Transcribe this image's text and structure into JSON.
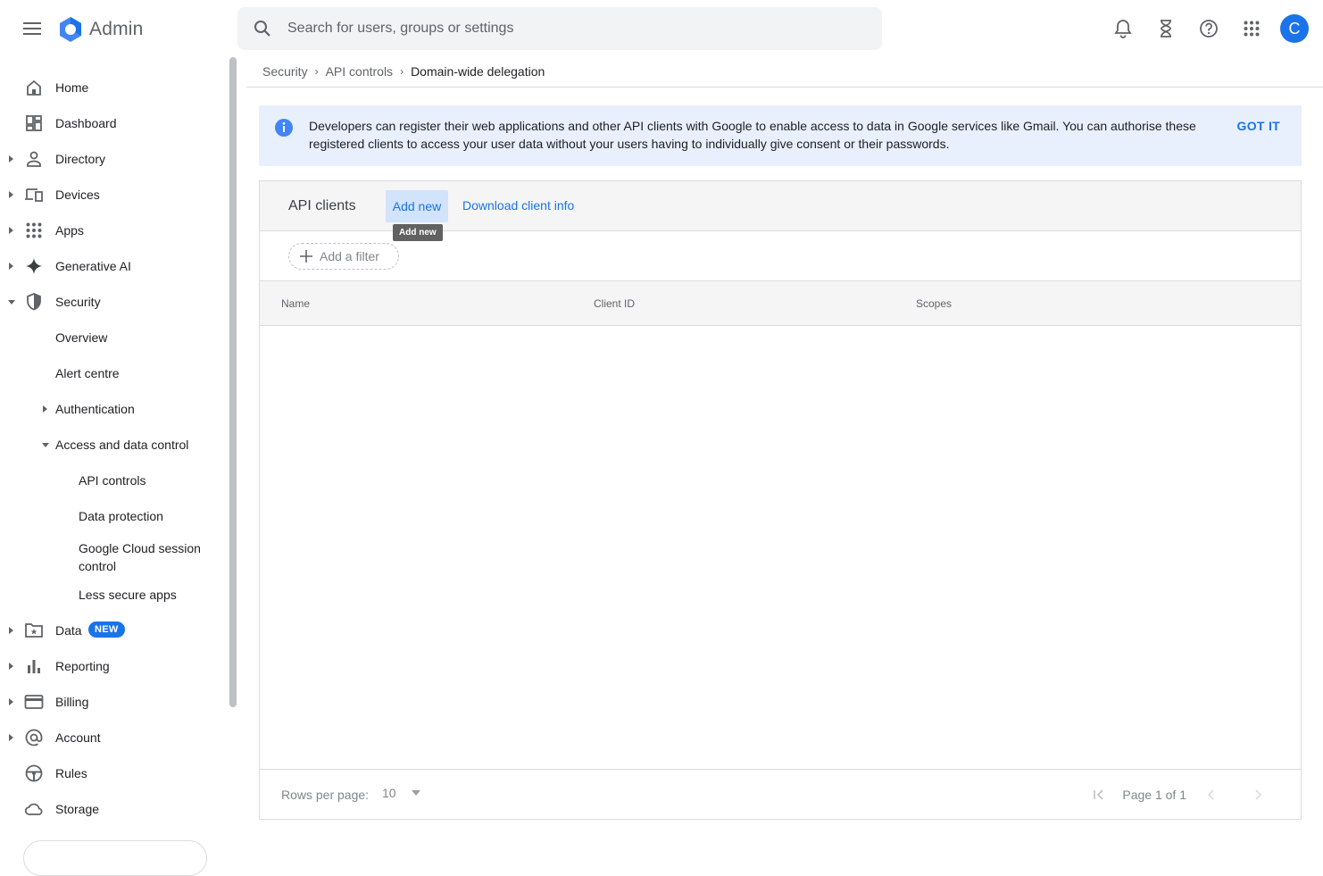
{
  "app": {
    "title": "Admin",
    "avatar_letter": "C",
    "accent": "#1a73e8"
  },
  "search": {
    "placeholder": "Search for users, groups or settings"
  },
  "sidebar": {
    "items": [
      {
        "label": "Home"
      },
      {
        "label": "Dashboard"
      },
      {
        "label": "Directory"
      },
      {
        "label": "Devices"
      },
      {
        "label": "Apps"
      },
      {
        "label": "Generative AI"
      },
      {
        "label": "Security"
      },
      {
        "label": "Overview"
      },
      {
        "label": "Alert centre"
      },
      {
        "label": "Authentication"
      },
      {
        "label": "Access and data control"
      },
      {
        "label": "API controls"
      },
      {
        "label": "Data protection"
      },
      {
        "label": "Google Cloud session control"
      },
      {
        "label": "Less secure apps"
      },
      {
        "label": "Data",
        "badge": "NEW"
      },
      {
        "label": "Reporting"
      },
      {
        "label": "Billing"
      },
      {
        "label": "Account"
      },
      {
        "label": "Rules"
      },
      {
        "label": "Storage"
      }
    ]
  },
  "breadcrumb": {
    "items": [
      "Security",
      "API controls"
    ],
    "current": "Domain-wide delegation"
  },
  "banner": {
    "text": "Developers can register their web applications and other API clients with Google to enable access to data in Google services like Gmail. You can authorise these registered clients to access your user data without your users having to individually give consent or their passwords.",
    "action": "GOT IT"
  },
  "api_clients": {
    "title": "API clients",
    "add_new": "Add new",
    "download": "Download client info",
    "tooltip": "Add new",
    "filter": "Add a filter",
    "columns": [
      "Name",
      "Client ID",
      "Scopes"
    ],
    "rows": [],
    "rows_per_page_label": "Rows per page:",
    "rows_per_page": "10",
    "page_text": "Page 1 of 1"
  }
}
